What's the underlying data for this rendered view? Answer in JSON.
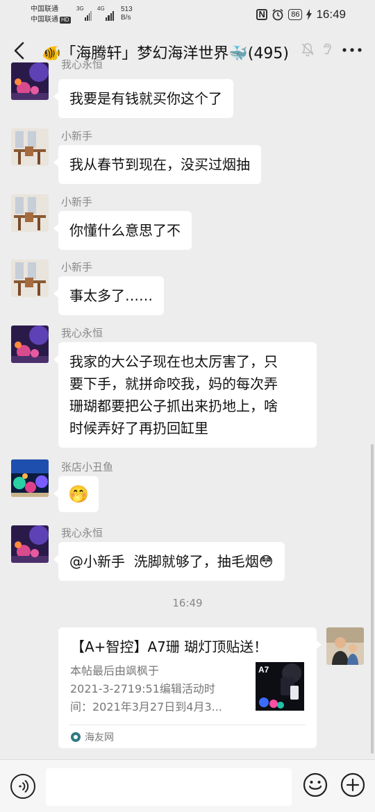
{
  "status_bar": {
    "carrier1": "中国联通",
    "carrier2": "中国联通",
    "carrier2_badge": "HD",
    "network1": "3G",
    "network2": "4G",
    "speed_value": "513",
    "speed_unit": "B/s",
    "battery": "86",
    "time": "16:49"
  },
  "header": {
    "title": "🐠「海腾轩」梦幻海洋世界🐳(495)",
    "back_icon": "chevron-left-icon",
    "icons": [
      "mute-bell-icon",
      "ear-icon",
      "more-icon"
    ]
  },
  "messages": [
    {
      "sender": "我心永恒",
      "text": "我要是有钱就买你这个了",
      "avatar": "coral-reef-avatar"
    },
    {
      "sender": "小新手",
      "text": "我从春节到现在，没买过烟抽",
      "avatar": "dining-room-avatar"
    },
    {
      "sender": "小新手",
      "text": "你懂什么意思了不",
      "avatar": "dining-room-avatar"
    },
    {
      "sender": "小新手",
      "text": "事太多了……",
      "avatar": "dining-room-avatar"
    },
    {
      "sender": "我心永恒",
      "text_lines": [
        "我家的大公子现在也太厉害了，只",
        "要下手，就拼命咬我，妈的每次弄",
        "珊瑚都要把公子抓出来扔地上，啥",
        "时候弄好了再扔回缸里"
      ],
      "avatar": "coral-reef-avatar"
    },
    {
      "sender": "张店小丑鱼",
      "text": "🤭",
      "avatar": "reef-tank-avatar"
    },
    {
      "sender": "我心永恒",
      "text": "@小新手  洗脚就够了，抽毛烟😳",
      "avatar": "coral-reef-avatar"
    }
  ],
  "timestamp": "16:49",
  "link_card": {
    "title": "【A+智控】A7珊 瑚灯顶贴送！",
    "desc_lines": [
      "本帖最后由飒枫于",
      "2021-3-2719:51编辑活动时",
      "间：2021年3月27日到4月3..."
    ],
    "thumb_label": "A7",
    "source": "海友网"
  },
  "input_bar": {
    "placeholder": "",
    "icons": [
      "voice-icon",
      "emoji-icon",
      "plus-icon"
    ]
  },
  "colors": {
    "background": "#ededed",
    "bubble": "#ffffff",
    "meta_text": "#888888"
  }
}
